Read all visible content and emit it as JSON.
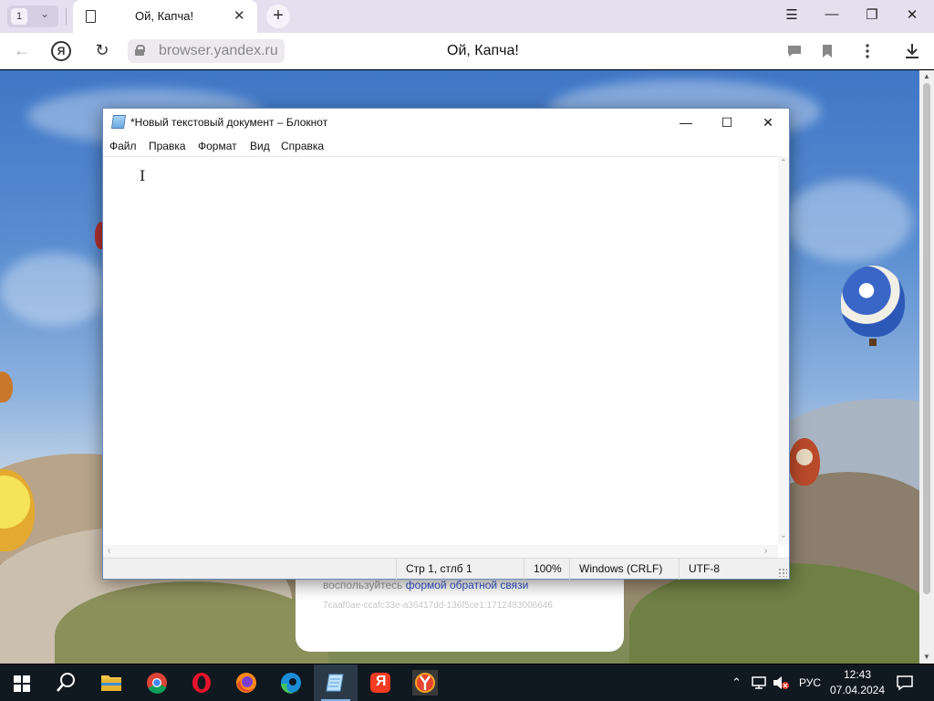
{
  "browser": {
    "tab_count": "1",
    "active_tab_title": "Ой, Капча!",
    "url_domain": "browser.yandex.ru",
    "page_title": "Ой, Капча!",
    "yandex_button": "Я"
  },
  "captcha_card": {
    "text_prefix": "воспользуйтесь",
    "feedback_link": "формой обратной связи",
    "request_id": "7caaf0ae-ccafc33e-a36417dd-136f5ce1:1712483006646"
  },
  "notepad": {
    "title": "*Новый текстовый документ – Блокнот",
    "menu": [
      "Файл",
      "Правка",
      "Формат",
      "Вид",
      "Справка"
    ],
    "caret": "I",
    "status": {
      "position": "Стр 1, стлб 1",
      "zoom": "100%",
      "line_endings": "Windows (CRLF)",
      "encoding": "UTF-8"
    }
  },
  "taskbar": {
    "apps": [
      "start",
      "search",
      "file-explorer",
      "chrome",
      "opera",
      "firefox",
      "edge",
      "notepad",
      "yandex",
      "yandex-browser"
    ],
    "language": "РУС",
    "time": "12:43",
    "date": "07.04.2024",
    "yandex_label": "Я"
  },
  "colors": {
    "taskbar_bg": "#101820",
    "tabbar_bg": "#e6dff0",
    "yandex_red": "#f33a22"
  }
}
